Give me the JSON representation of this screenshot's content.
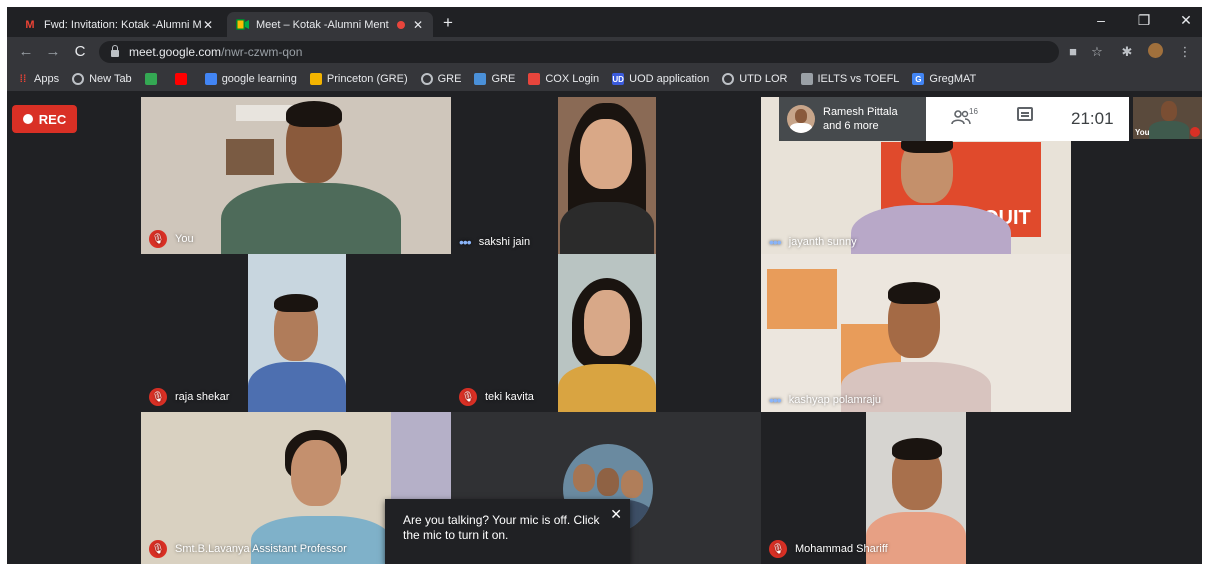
{
  "browser": {
    "tabs": [
      {
        "title": "Fwd: Invitation: Kotak -Alumni M",
        "icon": "gmail-icon",
        "active": false
      },
      {
        "title": "Meet – Kotak -Alumni Ment",
        "icon": "meet-icon",
        "active": true,
        "recording": true
      }
    ],
    "new_tab": "+",
    "window_controls": {
      "minimize": "–",
      "restore": "❐",
      "close": "✕"
    },
    "url_host": "meet.google.com",
    "url_path": "/nwr-czwm-qon",
    "bookmarks": [
      {
        "label": "Apps",
        "icon": "apps-grid-icon",
        "color": "#ea4335"
      },
      {
        "label": "New Tab",
        "icon": "globe-icon",
        "color": "#bdc1c6"
      },
      {
        "label": "",
        "icon": "flag-icon",
        "color": "#34a853"
      },
      {
        "label": "",
        "icon": "youtube-icon",
        "color": "#ff0000"
      },
      {
        "label": "google learning",
        "icon": "google-icon",
        "color": "#4285f4"
      },
      {
        "label": "Princeton (GRE)",
        "icon": "princeton-icon",
        "color": "#f4b400"
      },
      {
        "label": "GRE",
        "icon": "globe-icon",
        "color": "#bdc1c6"
      },
      {
        "label": "GRE",
        "icon": "gre-icon",
        "color": "#4a90d9"
      },
      {
        "label": "COX Login",
        "icon": "cox-icon",
        "color": "#e8453c"
      },
      {
        "label": "UOD application",
        "icon": "uod-icon",
        "color": "#3b5bdb",
        "glyph": "UD"
      },
      {
        "label": "UTD LOR",
        "icon": "globe-icon",
        "color": "#bdc1c6"
      },
      {
        "label": "IELTS vs TOEFL",
        "icon": "ielts-icon",
        "color": "#9aa0a6"
      },
      {
        "label": "GregMAT",
        "icon": "gregmat-icon",
        "color": "#4285f4",
        "glyph": "G"
      }
    ]
  },
  "meet": {
    "rec_label": "REC",
    "presenter_name": "Ramesh Pittala",
    "presenter_extra": "and 6 more",
    "people_count": "16",
    "time": "21:01",
    "self_thumb_label": "You",
    "toast_text": "Are you talking? Your mic is off. Click the mic to turn it on.",
    "toast_close": "✕",
    "tiles": [
      {
        "name": "You",
        "status": "muted"
      },
      {
        "name": "sakshi jain",
        "status": "speaking"
      },
      {
        "name": "jayanth sunny",
        "status": "speaking"
      },
      {
        "name": "raja shekar",
        "status": "muted"
      },
      {
        "name": "teki kavita",
        "status": "muted"
      },
      {
        "name": "kashyap polamraju",
        "status": "speaking"
      },
      {
        "name": "Smt.B.Lavanya Assistant Professor",
        "status": "muted"
      },
      {
        "name": "",
        "status": "none"
      },
      {
        "name": "Mohammad Shariff",
        "status": "muted"
      }
    ],
    "colors": {
      "meet_bg": "#202124",
      "mic_off": "#d93025",
      "speaking": "#8ab4f8"
    }
  }
}
